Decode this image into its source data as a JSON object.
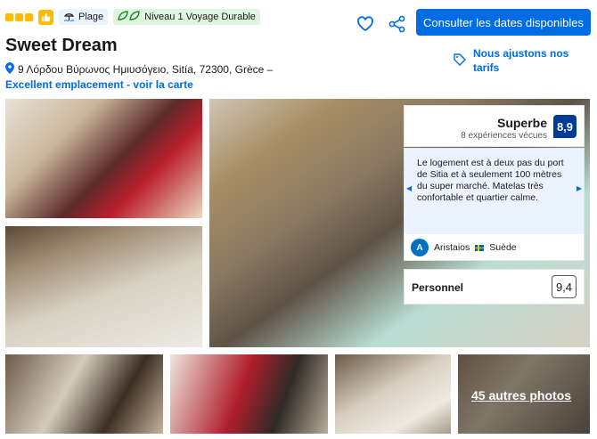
{
  "header": {
    "beach_label": "Plage",
    "sustainability_label": "Niveau 1 Voyage Durable",
    "cta_label": "Consulter les dates disponibles"
  },
  "property": {
    "name": "Sweet Dream",
    "address": "9 Λόρδου Βύρωνος Ημιυσόγειο, Sitía, 72300, Grèce –",
    "map_link": "Excellent emplacement - voir la carte",
    "price_match": "Nous ajustons nos tarifs"
  },
  "rating": {
    "word": "Superbe",
    "count": "8 expériences vécues",
    "score": "8,9"
  },
  "review": {
    "text": "Le logement est à deux pas du port de Sitia et à seulement 100 mètres du super marché. Matelas très confortable et quartier calme.",
    "avatar_initial": "A",
    "reviewer": "Aristaios",
    "country": "Suède"
  },
  "staff": {
    "label": "Personnel",
    "score": "9,4"
  },
  "gallery": {
    "more_photos": "45 autres photos"
  },
  "colors": {
    "brand_blue": "#006ce4",
    "score_navy": "#003b95",
    "star_yellow": "#febb02"
  }
}
